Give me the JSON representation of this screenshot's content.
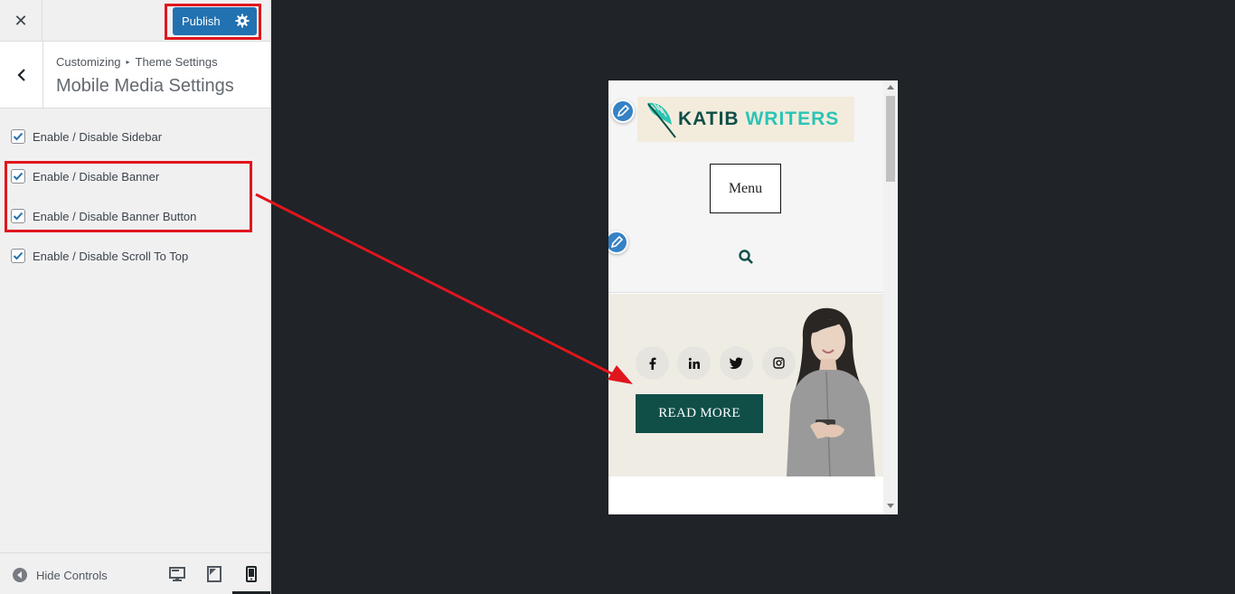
{
  "topbar": {
    "close_glyph": "✕",
    "publish_label": "Publish",
    "publish_settings_icon": "gear-icon"
  },
  "section": {
    "breadcrumb_root": "Customizing",
    "breadcrumb_current": "Theme Settings",
    "title": "Mobile Media Settings"
  },
  "options": [
    {
      "label": "Enable / Disable Sidebar",
      "checked": true
    },
    {
      "label": "Enable / Disable Banner",
      "checked": true
    },
    {
      "label": "Enable / Disable Banner Button",
      "checked": true
    },
    {
      "label": "Enable / Disable Scroll To Top",
      "checked": true
    }
  ],
  "footer": {
    "hide_controls_label": "Hide Controls",
    "devices": [
      "desktop-icon",
      "tablet-icon",
      "mobile-icon"
    ],
    "active_device": "mobile"
  },
  "preview": {
    "logo_word1": "KATIB",
    "logo_word2": "WRITERS",
    "menu_label": "Menu",
    "social_icons": [
      "facebook-icon",
      "linkedin-icon",
      "twitter-icon",
      "instagram-icon"
    ],
    "banner_button_label": "READ MORE"
  },
  "colors": {
    "publish_blue": "#2271b1",
    "highlight_red": "#e0161d",
    "brand_dark_green": "#0f4f48",
    "brand_teal": "#2cc4b5",
    "canvas_bg": "#202328"
  }
}
